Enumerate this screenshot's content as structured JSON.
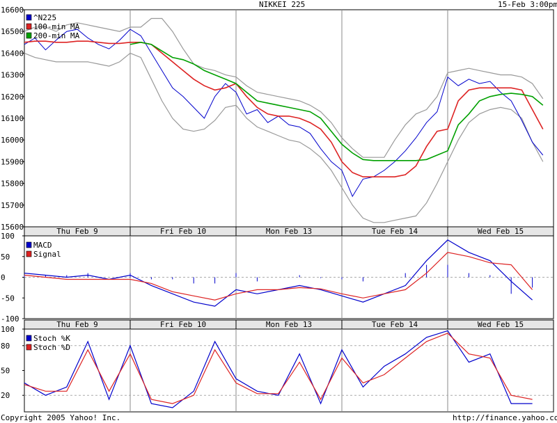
{
  "header": {
    "title": "NIKKEI 225",
    "timestamp": "15-Feb 3:00pm"
  },
  "footer": {
    "copyright": "Copyright 2005 Yahoo! Inc.",
    "url": "http://finance.yahoo.com/"
  },
  "days": [
    "Thu Feb  9",
    "Fri Feb 10",
    "Mon Feb 13",
    "Tue Feb 14",
    "Wed Feb 15"
  ],
  "colors": {
    "index": "#0000cc",
    "ma100": "#dd2222",
    "ma200": "#00a000",
    "band": "#999999",
    "macd": "#0000cc",
    "signal": "#dd2222",
    "stoch_k": "#0000cc",
    "stoch_d": "#dd2222"
  },
  "chart_data": [
    {
      "type": "line",
      "panel": "price",
      "ylim": [
        15600,
        16600
      ],
      "yticks": [
        15600,
        15700,
        15800,
        15900,
        16000,
        16100,
        16200,
        16300,
        16400,
        16500,
        16600
      ],
      "x": [
        0.0,
        0.1,
        0.2,
        0.3,
        0.4,
        0.5,
        0.6,
        0.7,
        0.8,
        0.9,
        1.0,
        1.1,
        1.2,
        1.3,
        1.4,
        1.5,
        1.6,
        1.7,
        1.8,
        1.9,
        2.0,
        2.1,
        2.2,
        2.3,
        2.4,
        2.5,
        2.6,
        2.7,
        2.8,
        2.9,
        3.0,
        3.1,
        3.2,
        3.3,
        3.4,
        3.5,
        3.6,
        3.7,
        3.8,
        3.9,
        4.0,
        4.1,
        4.2,
        4.3,
        4.4,
        4.5,
        4.6,
        4.7,
        4.8,
        4.9
      ],
      "series": [
        {
          "name": "^N225",
          "key": "index",
          "values": [
            16440,
            16470,
            16415,
            16460,
            16500,
            16510,
            16470,
            16440,
            16420,
            16460,
            16510,
            16480,
            16400,
            16320,
            16240,
            16200,
            16150,
            16100,
            16200,
            16260,
            16220,
            16120,
            16140,
            16080,
            16110,
            16070,
            16060,
            16030,
            15960,
            15900,
            15860,
            15740,
            15820,
            15830,
            15860,
            15900,
            15950,
            16010,
            16080,
            16130,
            16290,
            16250,
            16280,
            16260,
            16270,
            16220,
            16180,
            16090,
            15990,
            15930
          ]
        },
        {
          "name": "100-min MA",
          "key": "ma100",
          "values": [
            16450,
            16455,
            16455,
            16450,
            16450,
            16455,
            16455,
            16450,
            16445,
            16445,
            16450,
            16450,
            16440,
            16400,
            16360,
            16320,
            16280,
            16250,
            16230,
            16240,
            16260,
            16200,
            16150,
            16120,
            16110,
            16110,
            16100,
            16080,
            16050,
            15990,
            15900,
            15850,
            15830,
            15830,
            15830,
            15830,
            15840,
            15880,
            15970,
            16040,
            16050,
            16180,
            16230,
            16240,
            16240,
            16240,
            16240,
            16230,
            16140,
            16050
          ]
        },
        {
          "name": "200-min MA",
          "key": "ma200",
          "values": [
            null,
            null,
            null,
            null,
            null,
            null,
            null,
            null,
            null,
            null,
            16440,
            16450,
            16440,
            16410,
            16380,
            16370,
            16350,
            16320,
            16300,
            16280,
            16260,
            16220,
            16180,
            16170,
            16160,
            16150,
            16140,
            16130,
            16100,
            16040,
            15980,
            15940,
            15910,
            15905,
            15905,
            15905,
            15905,
            15905,
            15910,
            15930,
            15950,
            16070,
            16120,
            16180,
            16200,
            16210,
            16215,
            16210,
            16200,
            16160
          ]
        }
      ],
      "bands": {
        "upper": [
          16500,
          16520,
          16520,
          16500,
          16530,
          16540,
          16530,
          16520,
          16510,
          16500,
          16520,
          16520,
          16560,
          16560,
          16500,
          16420,
          16350,
          16330,
          16320,
          16300,
          16290,
          16250,
          16220,
          16210,
          16200,
          16190,
          16180,
          16160,
          16130,
          16080,
          16010,
          15960,
          15920,
          15920,
          15920,
          16000,
          16070,
          16120,
          16140,
          16200,
          16310,
          16320,
          16330,
          16320,
          16310,
          16300,
          16300,
          16290,
          16260,
          16190
        ],
        "lower": [
          16400,
          16380,
          16370,
          16360,
          16360,
          16360,
          16360,
          16350,
          16340,
          16360,
          16400,
          16380,
          16280,
          16180,
          16100,
          16050,
          16040,
          16050,
          16090,
          16150,
          16160,
          16100,
          16060,
          16040,
          16020,
          16000,
          15990,
          15960,
          15920,
          15860,
          15780,
          15700,
          15640,
          15620,
          15620,
          15630,
          15640,
          15650,
          15710,
          15800,
          15900,
          16000,
          16080,
          16120,
          16140,
          16150,
          16140,
          16100,
          15990,
          15900
        ]
      }
    },
    {
      "type": "line",
      "panel": "macd",
      "ylim": [
        -100,
        100
      ],
      "yticks": [
        -100,
        -50,
        0,
        50,
        100
      ],
      "x": [
        0.0,
        0.2,
        0.4,
        0.6,
        0.8,
        1.0,
        1.2,
        1.4,
        1.6,
        1.8,
        2.0,
        2.2,
        2.4,
        2.6,
        2.8,
        3.0,
        3.2,
        3.4,
        3.6,
        3.8,
        4.0,
        4.2,
        4.4,
        4.6,
        4.8
      ],
      "series": [
        {
          "name": "MACD",
          "key": "macd",
          "values": [
            10,
            5,
            0,
            5,
            -5,
            5,
            -20,
            -40,
            -60,
            -70,
            -30,
            -40,
            -30,
            -20,
            -30,
            -45,
            -60,
            -40,
            -20,
            40,
            90,
            60,
            40,
            -10,
            -55
          ]
        },
        {
          "name": "Signal",
          "key": "signal",
          "values": [
            5,
            0,
            -5,
            -5,
            -5,
            -5,
            -15,
            -35,
            -45,
            -55,
            -40,
            -30,
            -30,
            -25,
            -28,
            -40,
            -50,
            -40,
            -30,
            10,
            60,
            50,
            35,
            30,
            -30
          ]
        }
      ]
    },
    {
      "type": "line",
      "panel": "stochastic",
      "ylim": [
        0,
        100
      ],
      "yticks": [
        20,
        50,
        80,
        100
      ],
      "x": [
        0.0,
        0.2,
        0.4,
        0.6,
        0.8,
        1.0,
        1.2,
        1.4,
        1.6,
        1.8,
        2.0,
        2.2,
        2.4,
        2.6,
        2.8,
        3.0,
        3.2,
        3.4,
        3.6,
        3.8,
        4.0,
        4.2,
        4.4,
        4.6,
        4.8
      ],
      "series": [
        {
          "name": "Stoch %K",
          "key": "stoch_k",
          "values": [
            35,
            20,
            30,
            85,
            15,
            80,
            10,
            5,
            25,
            85,
            40,
            25,
            20,
            70,
            10,
            75,
            30,
            55,
            70,
            90,
            98,
            60,
            70,
            10,
            10
          ]
        },
        {
          "name": "Stoch %D",
          "key": "stoch_d",
          "values": [
            33,
            25,
            25,
            75,
            25,
            70,
            15,
            10,
            20,
            75,
            35,
            22,
            22,
            60,
            15,
            65,
            35,
            45,
            65,
            85,
            95,
            70,
            65,
            20,
            15
          ]
        }
      ]
    }
  ]
}
